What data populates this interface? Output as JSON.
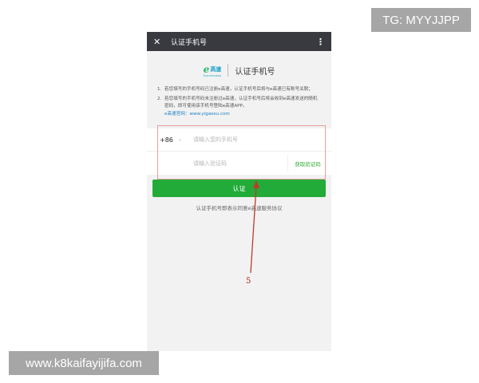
{
  "overlays": {
    "tg_badge": "TG: MYYJJPP",
    "site_badge": "www.k8kaifayijifa.com",
    "annotation_number": "5"
  },
  "titlebar": {
    "close_icon": "close-icon",
    "title": "认证手机号",
    "more_icon": "more-vertical-icon"
  },
  "brand": {
    "logo_mark": "e",
    "logo_text": "高速",
    "logo_sub": "Expressway",
    "heading": "认证手机号"
  },
  "notes": {
    "items": [
      {
        "num": "1.",
        "text": "若您填写的手机号码已注册e高速，认证手机号后将与e高速已有账号关联；"
      },
      {
        "num": "2.",
        "text": "若您填写的手机号码未注册过e高速，认证手机号后将会收到e高速发送的随机密码，即可使用该手机号登陆e高速APP。"
      }
    ],
    "official_site": "e高速官网：www.yigaosu.com"
  },
  "form": {
    "country_code": "+86",
    "chevron_icon": "chevron-right-icon",
    "phone_placeholder": "请输入您的手机号",
    "code_placeholder": "请输入验证码",
    "get_code_label": "获取验证码"
  },
  "actions": {
    "verify_label": "认证",
    "agreement": "认证手机号即表示同意e高速服务协议"
  },
  "colors": {
    "titlebar": "#393a3f",
    "primary_green": "#22ab38",
    "link_green": "#2fae37",
    "annotation_red": "#c0392b"
  }
}
